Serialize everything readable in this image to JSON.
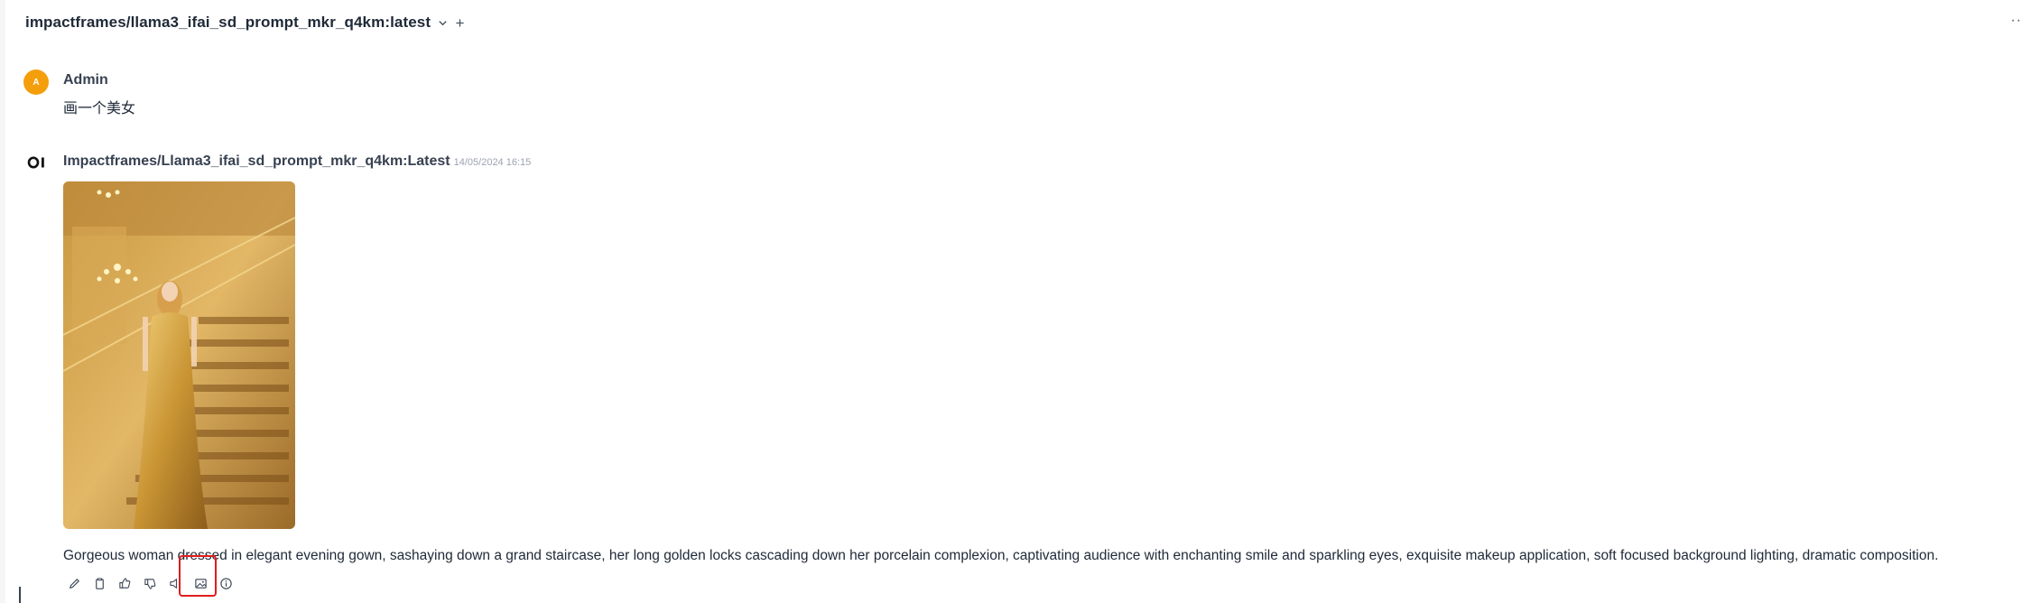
{
  "header": {
    "model_name": "impactframes/llama3_ifai_sd_prompt_mkr_q4km:latest",
    "more_label": "··"
  },
  "messages": {
    "user": {
      "avatar_letter": "A",
      "name": "Admin",
      "text": "画一个美女"
    },
    "assistant": {
      "name": "Impactframes/Llama3_ifai_sd_prompt_mkr_q4km:Latest",
      "timestamp": "14/05/2024 16:15",
      "avatar_text": "OI",
      "image_alt": "Generated image",
      "text": "Gorgeous woman dressed in elegant evening gown, sashaying down a grand staircase, her long golden locks cascading down her porcelain complexion, captivating audience with enchanting smile and sparkling eyes, exquisite makeup application, soft focused background lighting, dramatic composition."
    }
  },
  "actions": [
    {
      "name": "edit",
      "icon": "pencil-icon"
    },
    {
      "name": "copy",
      "icon": "clipboard-icon"
    },
    {
      "name": "good-response",
      "icon": "thumbs-up-icon"
    },
    {
      "name": "bad-response",
      "icon": "thumbs-down-icon"
    },
    {
      "name": "read-aloud",
      "icon": "speaker-icon"
    },
    {
      "name": "generate-image",
      "icon": "image-icon"
    },
    {
      "name": "generation-info",
      "icon": "info-icon"
    }
  ],
  "colors": {
    "user_avatar": "#f59e0b",
    "highlight": "#e11d1d",
    "text": "#1f2937"
  }
}
